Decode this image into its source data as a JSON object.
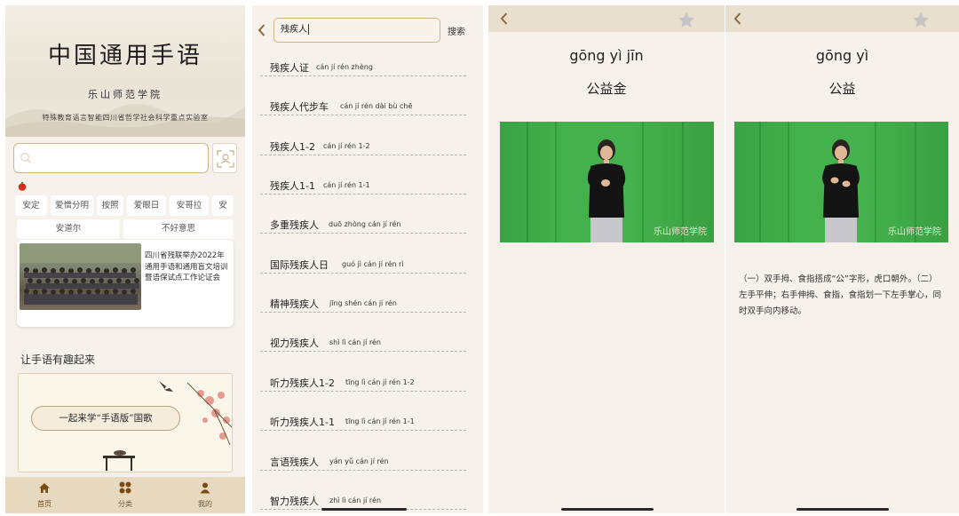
{
  "home": {
    "title": "中国通用手语",
    "institution": "乐山师范学院",
    "lab": "特殊教育语言智能四川省哲学社会科学重点实验室",
    "search_placeholder": "",
    "hot_words_row1": [
      "安定",
      "爱憎分明",
      "按照",
      "爱眼日",
      "安哥拉",
      "安"
    ],
    "hot_words_row2": [
      "安道尔",
      "不好意思"
    ],
    "news_text": "四川省残联举办2022年通用手语和通用盲文培训暨语保试点工作论证会",
    "section_title": "让手语有趣起来",
    "banner_text": "一起来学“手语版”国歌",
    "tabs": [
      {
        "label": "首页",
        "icon": "home-icon"
      },
      {
        "label": "分类",
        "icon": "category-icon"
      },
      {
        "label": "我的",
        "icon": "user-icon"
      }
    ],
    "accent": "#d3b487",
    "tabbar_bg": "#e7d9bf"
  },
  "search": {
    "query": "残疾人",
    "button_label": "搜索",
    "results": [
      {
        "zh": "残疾人证",
        "py": "cán jí rén zhèng"
      },
      {
        "zh": "残疾人代步车",
        "py": "cán jí rén dài bù chē"
      },
      {
        "zh": "残疾人1-2",
        "py": "cán jí rén 1-2"
      },
      {
        "zh": "残疾人1-1",
        "py": "cán jí rén 1-1"
      },
      {
        "zh": "多重残疾人",
        "py": "duō zhòng cán jí rén"
      },
      {
        "zh": "国际残疾人日",
        "py": "guó jì cán jí rén rì"
      },
      {
        "zh": "精神残疾人",
        "py": "jīng shén cán jí rén"
      },
      {
        "zh": "视力残疾人",
        "py": "shì lì cán jí rén"
      },
      {
        "zh": "听力残疾人1-2",
        "py": "tīng lì cán jí rén 1-2"
      },
      {
        "zh": "听力残疾人1-1",
        "py": "tīng lì cán jí rén 1-1"
      },
      {
        "zh": "言语残疾人",
        "py": "yán yǔ cán jí rén"
      },
      {
        "zh": "智力残疾人",
        "py": "zhì lì cán jí rén"
      }
    ]
  },
  "detail1": {
    "pinyin": "gōng yì jīn",
    "hanzi": "公益金",
    "watermark": "乐山师范学院"
  },
  "detail2": {
    "pinyin": "gōng yì",
    "hanzi": "公益",
    "watermark": "乐山师范学院",
    "description": "（一）双手拇、食指搭成“公”字形，虎口朝外。（二）左手平伸；右手伸拇、食指，食指划一下左手掌心，同时双手向内移动。"
  }
}
